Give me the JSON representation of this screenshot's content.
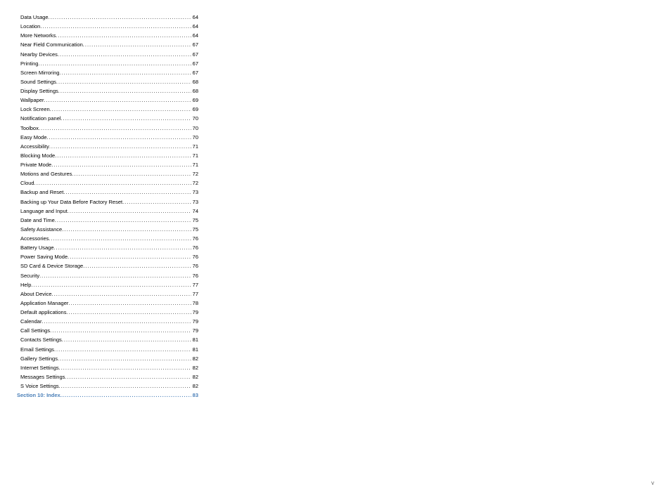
{
  "toc": {
    "entries": [
      {
        "label": "Data Usage",
        "page": "64",
        "type": "sub"
      },
      {
        "label": "Location",
        "page": "64",
        "type": "sub"
      },
      {
        "label": "More Networks",
        "page": "64",
        "type": "sub"
      },
      {
        "label": "Near Field Communication",
        "page": "67",
        "type": "sub"
      },
      {
        "label": "Nearby Devices",
        "page": "67",
        "type": "sub"
      },
      {
        "label": "Printing",
        "page": "67",
        "type": "sub"
      },
      {
        "label": "Screen Mirroring",
        "page": "67",
        "type": "sub"
      },
      {
        "label": "Sound Settings",
        "page": "68",
        "type": "sub"
      },
      {
        "label": "Display Settings",
        "page": "68",
        "type": "sub"
      },
      {
        "label": "Wallpaper",
        "page": "69",
        "type": "sub"
      },
      {
        "label": "Lock Screen",
        "page": "69",
        "type": "sub"
      },
      {
        "label": "Notification panel",
        "page": "70",
        "type": "sub"
      },
      {
        "label": "Toolbox",
        "page": "70",
        "type": "sub"
      },
      {
        "label": "Easy Mode",
        "page": "70",
        "type": "sub"
      },
      {
        "label": "Accessibility",
        "page": "71",
        "type": "sub"
      },
      {
        "label": "Blocking Mode",
        "page": "71",
        "type": "sub"
      },
      {
        "label": "Private Mode",
        "page": "71",
        "type": "sub"
      },
      {
        "label": "Motions and Gestures",
        "page": "72",
        "type": "sub"
      },
      {
        "label": "Cloud",
        "page": "72",
        "type": "sub"
      },
      {
        "label": "Backup and Reset",
        "page": "73",
        "type": "sub"
      },
      {
        "label": "Backing up Your Data Before Factory Reset",
        "page": "73",
        "type": "sub"
      },
      {
        "label": "Language and Input",
        "page": "74",
        "type": "sub"
      },
      {
        "label": "Date and Time",
        "page": "75",
        "type": "sub"
      },
      {
        "label": "Safety Assistance",
        "page": "75",
        "type": "sub"
      },
      {
        "label": "Accessories",
        "page": "76",
        "type": "sub"
      },
      {
        "label": "Battery Usage",
        "page": "76",
        "type": "sub"
      },
      {
        "label": "Power Saving Mode",
        "page": "76",
        "type": "sub"
      },
      {
        "label": "SD Card & Device Storage",
        "page": "76",
        "type": "sub"
      },
      {
        "label": "Security",
        "page": "76",
        "type": "sub"
      },
      {
        "label": "Help",
        "page": "77",
        "type": "sub"
      },
      {
        "label": "About Device",
        "page": "77",
        "type": "sub"
      },
      {
        "label": "Application Manager",
        "page": "78",
        "type": "sub"
      },
      {
        "label": "Default applications",
        "page": "79",
        "type": "sub"
      },
      {
        "label": "Calendar",
        "page": "79",
        "type": "sub"
      },
      {
        "label": "Call Settings",
        "page": "79",
        "type": "sub"
      },
      {
        "label": "Contacts Settings",
        "page": "81",
        "type": "sub"
      },
      {
        "label": "Email Settings",
        "page": "81",
        "type": "sub"
      },
      {
        "label": "Gallery Settings",
        "page": "82",
        "type": "sub"
      },
      {
        "label": "Internet Settings",
        "page": "82",
        "type": "sub"
      },
      {
        "label": "Messages Settings",
        "page": "82",
        "type": "sub"
      },
      {
        "label": "S Voice Settings",
        "page": "82",
        "type": "sub"
      },
      {
        "label": "Section 10: Index",
        "page": "83",
        "type": "section"
      }
    ]
  },
  "footer": {
    "page_number": "v"
  }
}
